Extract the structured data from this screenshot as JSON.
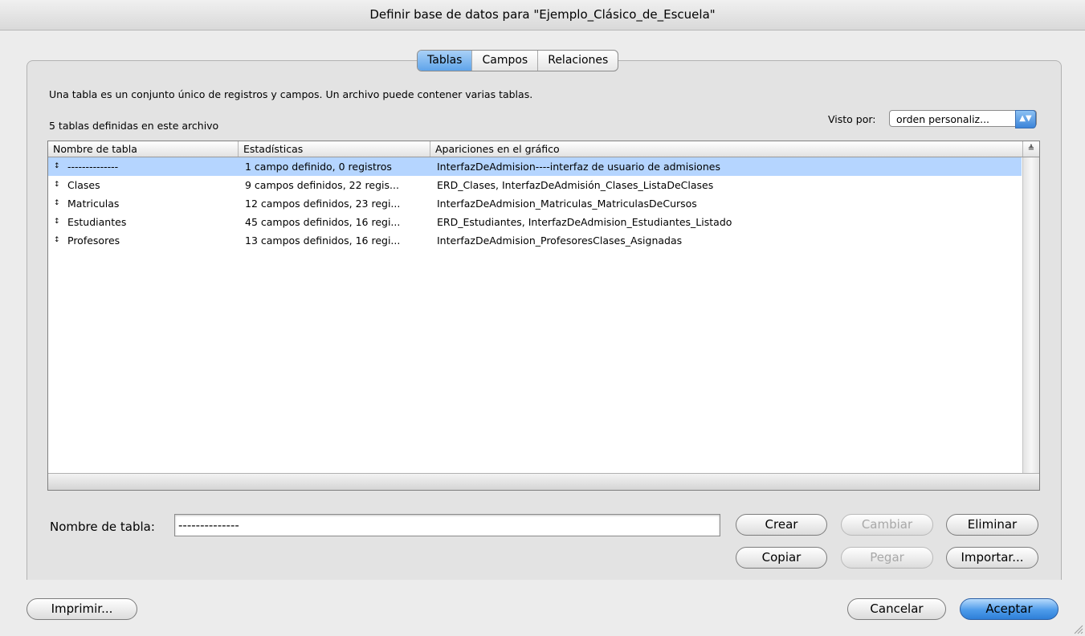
{
  "window": {
    "title": "Definir base de datos para \"Ejemplo_Clásico_de_Escuela\""
  },
  "tabs": [
    {
      "label": "Tablas",
      "selected": true
    },
    {
      "label": "Campos",
      "selected": false
    },
    {
      "label": "Relaciones",
      "selected": false
    }
  ],
  "description": "Una tabla es un conjunto único de registros y campos. Un archivo puede contener varias tablas.",
  "table_count": "5 tablas definidas en este archivo",
  "view_by": {
    "label": "Visto por:",
    "value": "orden personaliz..."
  },
  "table_list": {
    "columns": [
      "Nombre de tabla",
      "Estadísticas",
      "Apariciones en el gráfico"
    ],
    "rows": [
      {
        "name": "--------------",
        "stats": "1 campo definido, 0 registros",
        "occurrences": "InterfazDeAdmision----interfaz de usuario de admisiones",
        "selected": true
      },
      {
        "name": "Clases",
        "stats": "9 campos definidos, 22 regis...",
        "occurrences": "ERD_Clases, InterfazDeAdmisión_Clases_ListaDeClases",
        "selected": false
      },
      {
        "name": "Matriculas",
        "stats": "12 campos definidos, 23 regi...",
        "occurrences": "InterfazDeAdmision_Matriculas_MatriculasDeCursos",
        "selected": false
      },
      {
        "name": "Estudiantes",
        "stats": "45 campos definidos, 16 regi...",
        "occurrences": "ERD_Estudiantes, InterfazDeAdmision_Estudiantes_Listado",
        "selected": false
      },
      {
        "name": "Profesores",
        "stats": "13 campos definidos, 16 regi...",
        "occurrences": "InterfazDeAdmision_ProfesoresClases_Asignadas",
        "selected": false
      }
    ]
  },
  "table_name": {
    "label": "Nombre de tabla:",
    "value": "--------------"
  },
  "buttons": {
    "create": "Crear",
    "change": "Cambiar",
    "delete": "Eliminar",
    "copy": "Copiar",
    "paste": "Pegar",
    "import": "Importar...",
    "print": "Imprimir...",
    "cancel": "Cancelar",
    "ok": "Aceptar"
  },
  "icons": {
    "row_handle": "updown-arrows-icon",
    "sort": "sort-icon",
    "popup": "popup-arrows-icon",
    "resize": "resize-grip-icon"
  },
  "colors": {
    "selection": "#b5d5ff",
    "accent": "#4d9bea"
  }
}
